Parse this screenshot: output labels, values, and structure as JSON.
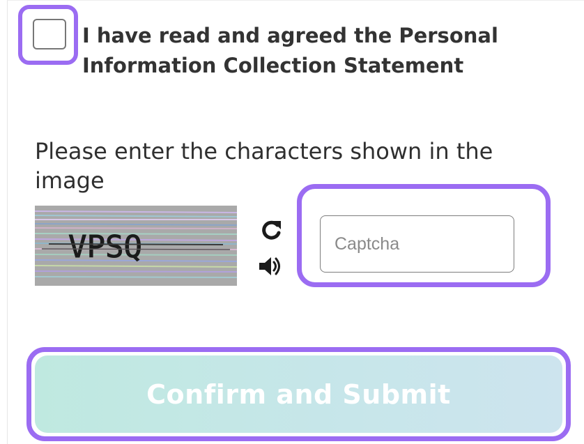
{
  "consent": {
    "checked": false,
    "label_line1": "I have read and agreed the Personal",
    "label_line2": "Information Collection Statement"
  },
  "captcha": {
    "instruction_line1": "Please enter the characters shown in the",
    "instruction_line2": "image",
    "image_text": "VPSQ",
    "refresh_icon": "refresh-icon",
    "audio_icon": "audio-icon",
    "input_value": "",
    "input_placeholder": "Captcha"
  },
  "submit": {
    "label": "Confirm and Submit"
  },
  "colors": {
    "highlight": "#9b6cf2",
    "button_start": "#bfe9e0",
    "button_end": "#cde4ee"
  }
}
